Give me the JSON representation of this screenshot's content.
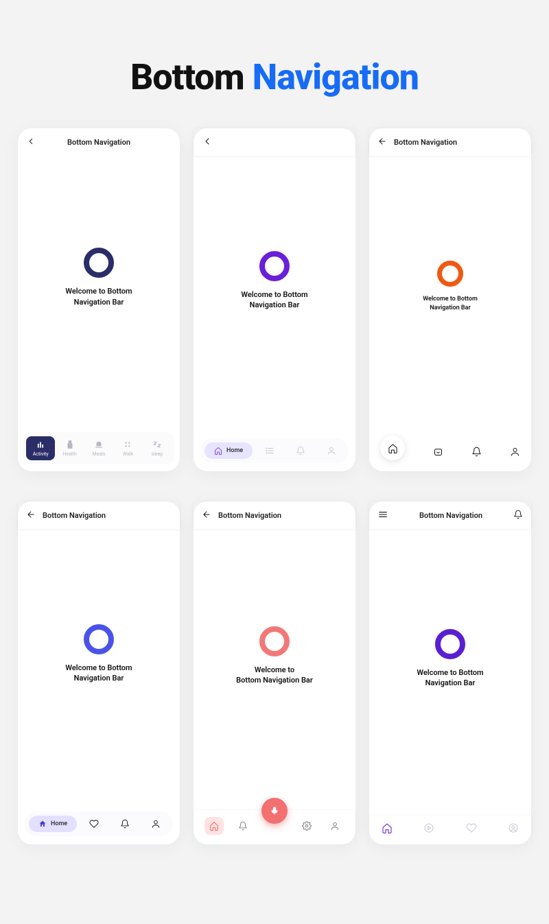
{
  "title": {
    "part1": "Bottom ",
    "part2": "Navigation"
  },
  "phones": [
    {
      "header": "Bottom Navigation",
      "ring_color": "#2a2d68",
      "welcome": "Welcome to Bottom\nNavigation Bar",
      "nav_items": [
        {
          "label": "Activity"
        },
        {
          "label": "Health"
        },
        {
          "label": "Meals"
        },
        {
          "label": "Walk"
        },
        {
          "label": "sleep"
        }
      ]
    },
    {
      "ring_color": "#6a1fd9",
      "welcome": "Welcome to Bottom\nNavigation Bar",
      "pill_label": "Home"
    },
    {
      "header": "Bottom Navigation",
      "ring_color": "#ef5a12",
      "welcome": "Welcome to Bottom\nNavigation Bar"
    },
    {
      "header": "Bottom Navigation",
      "ring_color": "#4a53e8",
      "welcome": "Welcome to Bottom\nNavigation Bar",
      "pill_label": "Home"
    },
    {
      "header": "Bottom Navigation",
      "ring_color": "#f27878",
      "welcome": "Welcome to\nBottom Navigation Bar"
    },
    {
      "header": "Bottom Navigation",
      "ring_color": "#5a1fd0",
      "welcome": "Welcome to Bottom\nNavigation Bar"
    }
  ]
}
